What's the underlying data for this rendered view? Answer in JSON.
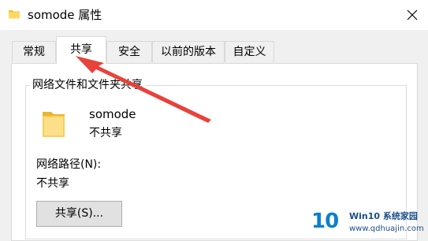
{
  "window": {
    "title": "somode 属性",
    "close_icon": "close-icon",
    "folder_icon": "folder-icon"
  },
  "tabs": [
    {
      "label": "常规",
      "active": false
    },
    {
      "label": "共享",
      "active": true
    },
    {
      "label": "安全",
      "active": false
    },
    {
      "label": "以前的版本",
      "active": false
    },
    {
      "label": "自定义",
      "active": false
    }
  ],
  "sharing": {
    "group_title": "网络文件和文件夹共享",
    "folder_name": "somode",
    "status": "不共享",
    "network_path_label": "网络路径(N):",
    "network_path_value": "不共享",
    "share_button": "共享(S)..."
  },
  "annotation": {
    "color": "#e8423b",
    "icon": "arrow-icon"
  },
  "watermark": {
    "logo_text": "10",
    "brand": "Win10 系统家园",
    "site": "www.qdhuajin.com"
  },
  "colors": {
    "folder": "#f4c430",
    "button_bg": "#e1e1e1",
    "button_border": "#adadad",
    "tab_border": "#d9d9d9"
  }
}
